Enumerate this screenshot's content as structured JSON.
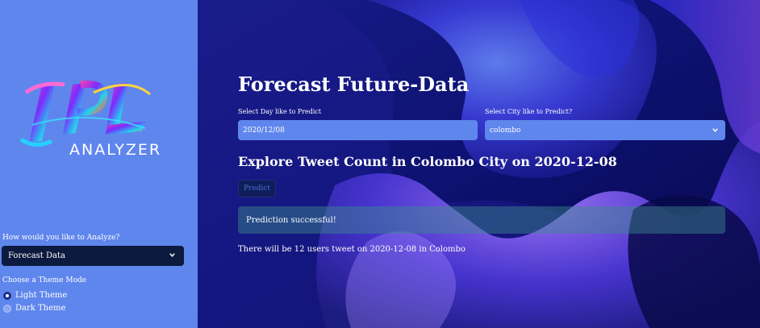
{
  "sidebar": {
    "logo": {
      "letters": "IPL",
      "word": "ANALYZER"
    },
    "analyze_label": "How would you like to Analyze?",
    "analyze_value": "Forecast Data",
    "theme_label": "Choose a Theme Mode",
    "theme_options": [
      "Light Theme",
      "Dark Theme"
    ],
    "theme_selected": "Light Theme"
  },
  "main": {
    "title": "Forecast Future-Data",
    "day_label": "Select Day like to Predict",
    "day_value": "2020/12/08",
    "city_label": "Select City like to Predict?",
    "city_value": "colombo",
    "subtitle": "Explore Tweet Count in Colombo City on 2020-12-08",
    "predict_button": "Predict",
    "success_message": "Prediction successful!",
    "result_text": "There will be 12 users tweet on 2020-12-08 in Colombo"
  },
  "colors": {
    "sidebar_bg": "#5f86ec",
    "select_bg": "#0d1a3f",
    "input_bg": "#5f86ec",
    "main_bg": "#0c0f5a"
  }
}
